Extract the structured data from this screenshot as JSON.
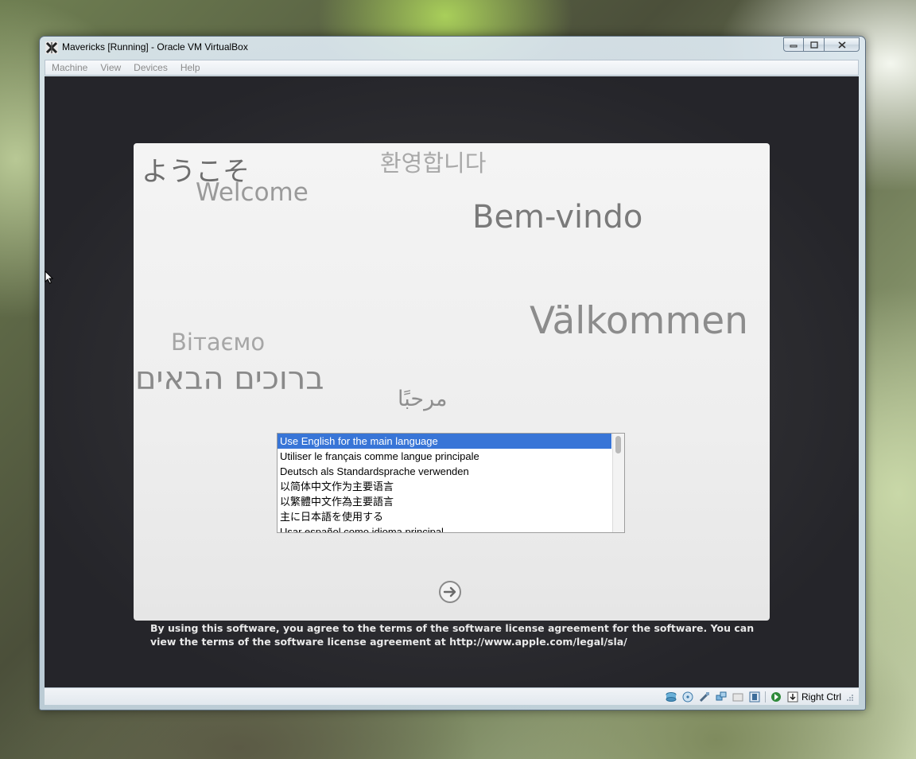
{
  "window": {
    "title": "Mavericks [Running] - Oracle VM VirtualBox"
  },
  "menu": {
    "items": [
      "Machine",
      "View",
      "Devices",
      "Help"
    ]
  },
  "greetings": {
    "japanese": "ようこそ",
    "english": "Welcome",
    "korean": "환영합니다",
    "portuguese": "Bem-vindo",
    "swedish": "Välkommen",
    "ukrainian": "Вітаємо",
    "hebrew": "ברוכים הבאים",
    "arabic": "مرحبًا"
  },
  "language_list": {
    "selected_index": 0,
    "items": [
      "Use English for the main language",
      "Utiliser le français comme langue principale",
      "Deutsch als Standardsprache verwenden",
      "以简体中文作为主要语言",
      "以繁體中文作為主要語言",
      "主に日本語を使用する",
      "Usar español como idioma principal"
    ]
  },
  "license_text": "By using this software, you agree to the terms of the software license agreement for the software. You can view the terms of the software license agreement at http://www.apple.com/legal/sla/",
  "statusbar": {
    "host_key": "Right Ctrl",
    "icons": [
      "hard-disk-icon",
      "optical-drive-icon",
      "usb-icon",
      "network-icon",
      "shared-folder-icon",
      "display-icon",
      "mouse-integration-icon",
      "keyboard-capture-icon"
    ]
  },
  "colors": {
    "selection": "#3875d7",
    "vm_background": "#2c2c30",
    "panel": "#eeeeee"
  }
}
